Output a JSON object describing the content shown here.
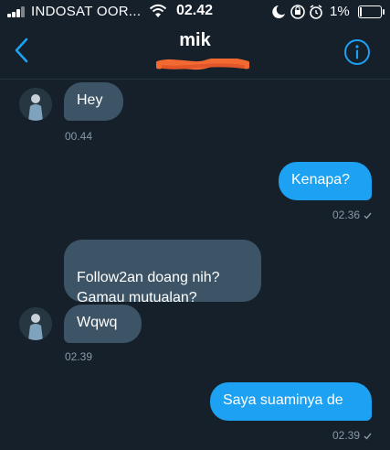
{
  "status": {
    "carrier": "INDOSAT OOR...",
    "time": "02.42",
    "battery": "1%",
    "battery_level": 0.01
  },
  "header": {
    "title": "mik"
  },
  "messages": [
    {
      "id": "m1",
      "side": "in",
      "text": "Hey",
      "timestamp": "00.44"
    },
    {
      "id": "m2",
      "side": "out",
      "text": "Kenapa?",
      "timestamp": "02.36"
    },
    {
      "id": "m3",
      "side": "in",
      "text": "Follow2an doang nih?\nGamau mutualan?"
    },
    {
      "id": "m4",
      "side": "in",
      "text": "Wqwq",
      "timestamp": "02.39"
    },
    {
      "id": "m5",
      "side": "out",
      "text": "Saya suaminya de",
      "timestamp": "02.39"
    }
  ],
  "colors": {
    "background": "#15202b",
    "incoming_bubble": "#3d5466",
    "outgoing_bubble": "#1da1f2",
    "accent": "#1da1f2",
    "timestamp": "#8899a6"
  },
  "icons": {
    "back": "chevron-left-icon",
    "info": "info-icon",
    "wifi": "wifi-icon",
    "read_receipt": "check-icon"
  }
}
